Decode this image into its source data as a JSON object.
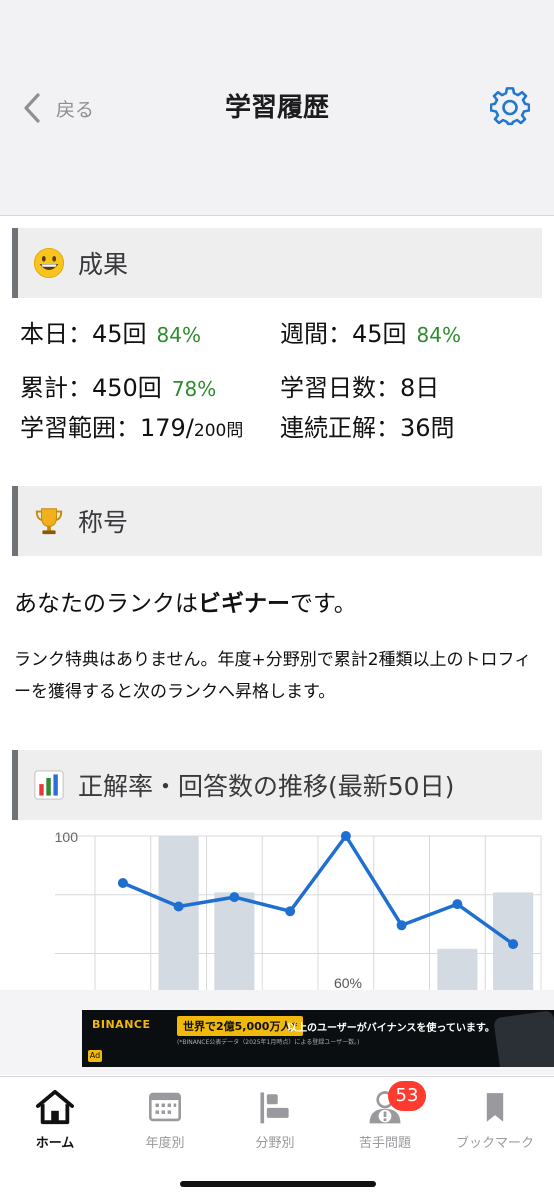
{
  "header": {
    "back_label": "戻る",
    "title": "学習履歴",
    "settings_icon": "gear-icon"
  },
  "results": {
    "title": "成果",
    "icon": "grinning-face-icon",
    "today_label": "本日：45回",
    "today_pct": "84%",
    "week_label": "週間：45回",
    "week_pct": "84%",
    "total_label": "累計：450回",
    "total_pct": "78%",
    "days_label": "学習日数：8日",
    "range_label": "学習範囲：179/",
    "range_total": "200問",
    "streak_label": "連続正解：36問"
  },
  "rank": {
    "title": "称号",
    "icon": "trophy-icon",
    "line_pre": "あなたのランクは",
    "line_rank": "ビギナー",
    "line_post": "です。",
    "note": "ランク特典はありません。年度+分野別で累計2種類以上のトロフィーを獲得すると次のランクへ昇格します。"
  },
  "trend": {
    "title": "正解率・回答数の推移(最新50日)",
    "icon": "bar-chart-icon"
  },
  "chart_data": {
    "type": "line",
    "ytick_top": "100",
    "line": [
      80,
      70,
      74,
      68,
      100,
      62,
      71,
      54
    ],
    "bars": [
      null,
      100,
      76,
      null,
      null,
      null,
      52,
      76
    ],
    "annotation": "60%",
    "colors": {
      "line": "#1f6fd1",
      "bar": "#d3dae2",
      "grid": "#d8d8d8"
    }
  },
  "ad": {
    "brand": "BINANCE",
    "badge": "世界で2億5,000万人*",
    "text": "以上のユーザーがバイナンスを使っています。",
    "note": "(*BINANCE公表データ（2025年1月時点）による登録ユーザー数。)",
    "mark": "Ad"
  },
  "tabs": [
    {
      "label": "ホーム",
      "icon": "home-icon",
      "active": true
    },
    {
      "label": "年度別",
      "icon": "calendar-icon",
      "active": false
    },
    {
      "label": "分野別",
      "icon": "category-bars-icon",
      "active": false
    },
    {
      "label": "苦手問題",
      "icon": "user-warning-icon",
      "active": false,
      "badge": "53"
    },
    {
      "label": "ブックマーク",
      "icon": "bookmark-icon",
      "active": false
    }
  ]
}
